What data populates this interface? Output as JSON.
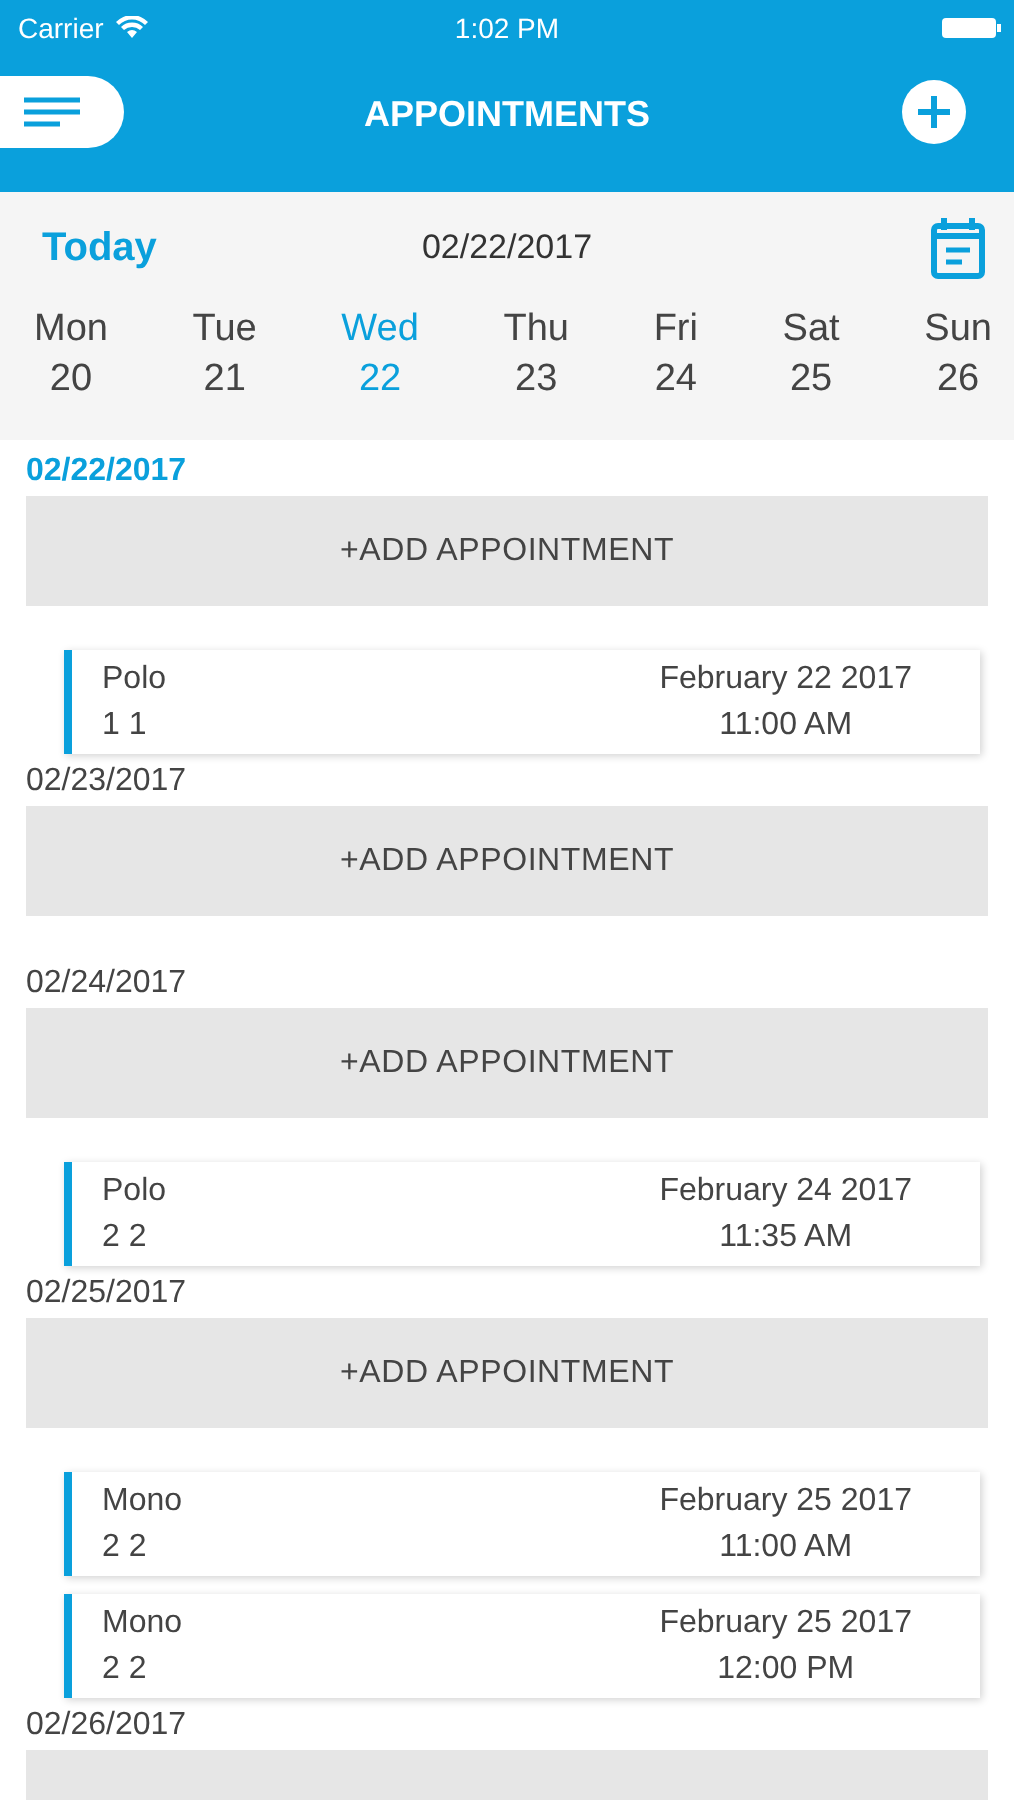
{
  "status_bar": {
    "carrier": "Carrier",
    "time": "1:02 PM"
  },
  "nav": {
    "title": "APPOINTMENTS"
  },
  "date_bar": {
    "today": "Today",
    "date": "02/22/2017"
  },
  "week": [
    {
      "day": "Mon",
      "num": "20",
      "selected": false
    },
    {
      "day": "Tue",
      "num": "21",
      "selected": false
    },
    {
      "day": "Wed",
      "num": "22",
      "selected": true
    },
    {
      "day": "Thu",
      "num": "23",
      "selected": false
    },
    {
      "day": "Fri",
      "num": "24",
      "selected": false
    },
    {
      "day": "Sat",
      "num": "25",
      "selected": false
    },
    {
      "day": "Sun",
      "num": "26",
      "selected": false
    }
  ],
  "sections": [
    {
      "date": "02/22/2017",
      "selected": true,
      "add_label": "+ADD APPOINTMENT",
      "appointments": [
        {
          "name": "Polo",
          "detail": "1 1",
          "date": "February 22 2017",
          "time": "11:00 AM"
        }
      ]
    },
    {
      "date": "02/23/2017",
      "selected": false,
      "add_label": "+ADD APPOINTMENT"
    },
    {
      "date": "02/24/2017",
      "selected": false,
      "add_label": "+ADD APPOINTMENT",
      "appointments": [
        {
          "name": "Polo",
          "detail": "2 2",
          "date": "February 24 2017",
          "time": "11:35 AM"
        }
      ]
    },
    {
      "date": "02/25/2017",
      "selected": false,
      "add_label": "+ADD APPOINTMENT",
      "appointments": [
        {
          "name": "Mono",
          "detail": "2 2",
          "date": "February 25 2017",
          "time": "11:00 AM"
        },
        {
          "name": "Mono",
          "detail": "2 2",
          "date": "February 25 2017",
          "time": "12:00 PM"
        }
      ]
    },
    {
      "date": "02/26/2017",
      "selected": false
    }
  ]
}
